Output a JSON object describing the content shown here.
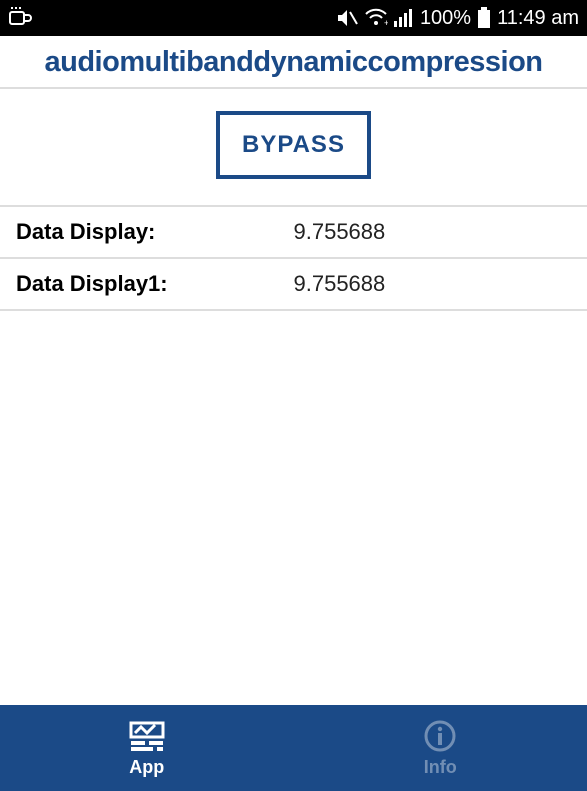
{
  "status": {
    "battery_pct": "100%",
    "time": "11:49 am"
  },
  "title": "audiomultibanddynamiccompression",
  "bypass_label": "BYPASS",
  "rows": [
    {
      "label": "Data Display:",
      "value": "9.755688"
    },
    {
      "label": "Data Display1:",
      "value": "9.755688"
    }
  ],
  "nav": {
    "app": {
      "label": "App",
      "active": true
    },
    "info": {
      "label": "Info",
      "active": false
    }
  }
}
